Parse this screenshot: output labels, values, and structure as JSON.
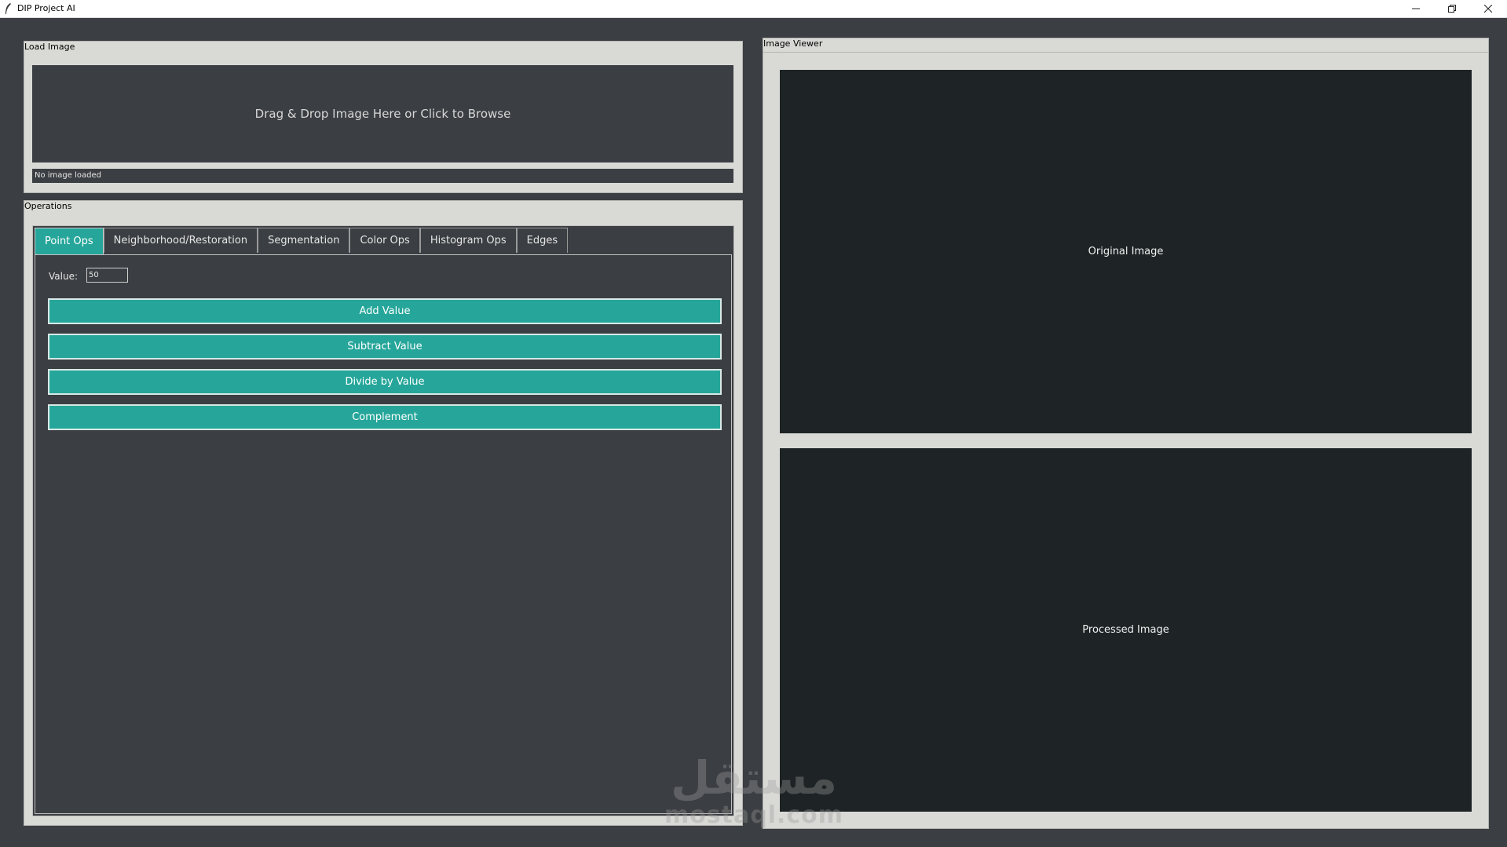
{
  "window": {
    "title": "DIP Project AI",
    "minimize_icon": "minimize-icon",
    "maximize_icon": "restore-icon",
    "close_icon": "close-icon"
  },
  "load_image": {
    "label": "Load Image",
    "dropzone_text": "Drag & Drop Image Here or Click to Browse",
    "status": "No image loaded"
  },
  "operations": {
    "label": "Operations",
    "tabs": [
      {
        "label": "Point Ops",
        "active": true
      },
      {
        "label": "Neighborhood/Restoration",
        "active": false
      },
      {
        "label": "Segmentation",
        "active": false
      },
      {
        "label": "Color Ops",
        "active": false
      },
      {
        "label": "Histogram Ops",
        "active": false
      },
      {
        "label": "Edges",
        "active": false
      }
    ],
    "value_label": "Value:",
    "value": "50",
    "buttons": [
      "Add Value",
      "Subtract Value",
      "Divide by Value",
      "Complement"
    ]
  },
  "image_viewer": {
    "label": "Image Viewer",
    "original_label": "Original Image",
    "processed_label": "Processed Image"
  },
  "watermark": {
    "arabic": "مستقل",
    "latin": "mostaql.com"
  },
  "colors": {
    "background": "#3b3e42",
    "panel": "#d9d9d6",
    "accent": "#26a69a",
    "image_frame": "#1e2426"
  }
}
